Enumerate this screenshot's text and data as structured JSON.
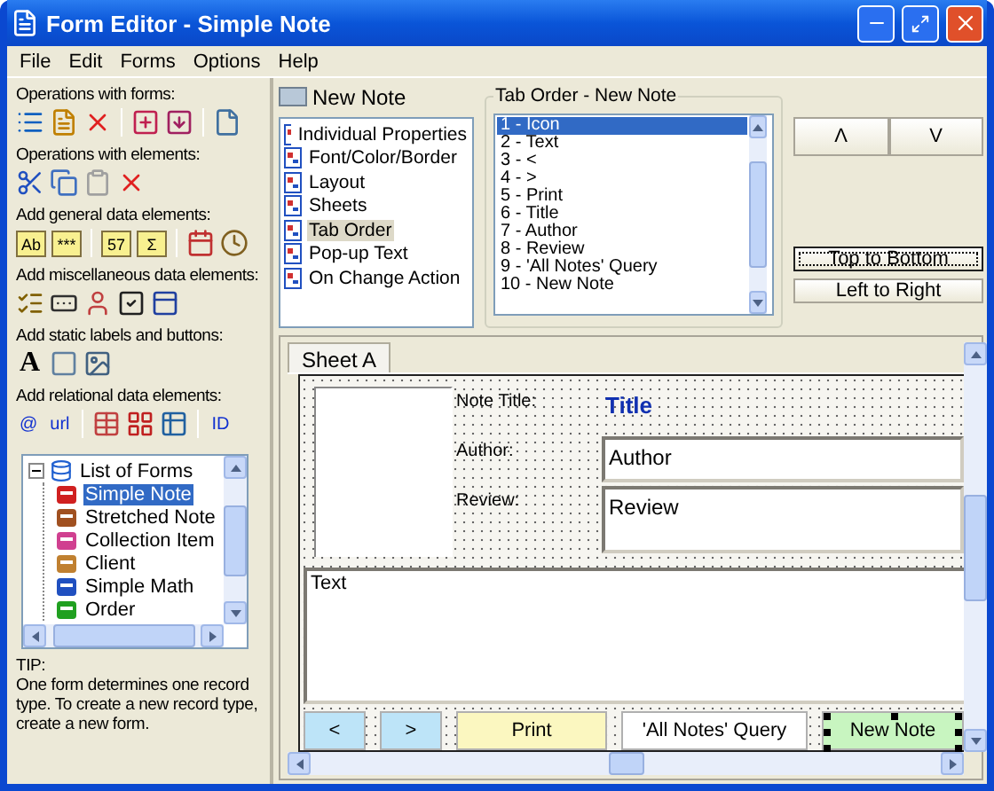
{
  "window": {
    "title": "Form Editor - Simple Note"
  },
  "menu": [
    "File",
    "Edit",
    "Forms",
    "Options",
    "Help"
  ],
  "toolbox": [
    {
      "title": "Operations with forms:",
      "items": [
        {
          "kind": "icon"
        },
        {
          "kind": "icon"
        },
        {
          "kind": "icon"
        },
        {
          "kind": "separator"
        },
        {
          "kind": "icon"
        },
        {
          "kind": "icon"
        },
        {
          "kind": "separator"
        },
        {
          "kind": "icon"
        }
      ]
    },
    {
      "title": "Operations with elements:",
      "items": [
        {
          "kind": "icon",
          "disabled": false
        },
        {
          "kind": "icon",
          "disabled": false
        },
        {
          "kind": "icon",
          "disabled": true
        },
        {
          "kind": "icon",
          "disabled": false
        }
      ]
    },
    {
      "title": "Add general data elements:",
      "items": [
        {
          "kind": "boxed",
          "text": "Ab"
        },
        {
          "kind": "boxed",
          "text": "***"
        },
        {
          "kind": "separator"
        },
        {
          "kind": "boxed",
          "text": "57"
        },
        {
          "kind": "boxed",
          "text": "Σ"
        },
        {
          "kind": "separator"
        },
        {
          "kind": "icon"
        },
        {
          "kind": "icon"
        }
      ]
    },
    {
      "title": "Add miscellaneous data elements:",
      "items": [
        {
          "kind": "icon"
        },
        {
          "kind": "icon"
        },
        {
          "kind": "icon"
        },
        {
          "kind": "icon"
        },
        {
          "kind": "icon"
        }
      ]
    },
    {
      "title": "Add static labels and buttons:",
      "items": [
        {
          "kind": "letter",
          "text": "A"
        },
        {
          "kind": "icon"
        },
        {
          "kind": "icon"
        }
      ]
    },
    {
      "title": "Add relational data elements:",
      "items": [
        {
          "kind": "link",
          "text": "@"
        },
        {
          "kind": "link",
          "text": "url"
        },
        {
          "kind": "separator"
        },
        {
          "kind": "icon"
        },
        {
          "kind": "icon"
        },
        {
          "kind": "icon"
        },
        {
          "kind": "separator"
        },
        {
          "kind": "link",
          "text": "ID"
        }
      ]
    }
  ],
  "forms_tree": {
    "label": "List of Forms",
    "expanded": true,
    "children": [
      {
        "label": "Simple Note",
        "selected": true
      },
      {
        "label": "Stretched Note",
        "selected": false
      },
      {
        "label": "Collection Item",
        "selected": false
      },
      {
        "label": "Client",
        "selected": false
      },
      {
        "label": "Simple Math",
        "selected": false
      },
      {
        "label": "Order",
        "selected": false
      }
    ]
  },
  "tip": {
    "title": "TIP:",
    "text": "One form determines one record type. To create a new record type, create a new form."
  },
  "form_header": "New Note",
  "property_pages": [
    {
      "label": "Individual Properties",
      "selected": false
    },
    {
      "label": "Font/Color/Border",
      "selected": false
    },
    {
      "label": "Layout",
      "selected": false
    },
    {
      "label": "Sheets",
      "selected": false
    },
    {
      "label": "Tab Order",
      "selected": true
    },
    {
      "label": "Pop-up Text",
      "selected": false
    },
    {
      "label": "On Change Action",
      "selected": false
    }
  ],
  "tab_order": {
    "title": "Tab Order - New Note",
    "items": [
      {
        "label": "1 - Icon",
        "selected": true
      },
      {
        "label": "2 - Text",
        "selected": false
      },
      {
        "label": "3 - <",
        "selected": false
      },
      {
        "label": "4 - >",
        "selected": false
      },
      {
        "label": "5 - Print",
        "selected": false
      },
      {
        "label": "6 - Title",
        "selected": false
      },
      {
        "label": "7 - Author",
        "selected": false
      },
      {
        "label": "8 - Review",
        "selected": false
      },
      {
        "label": "9 - 'All Notes' Query",
        "selected": false
      },
      {
        "label": "10 - New Note",
        "selected": false
      }
    ]
  },
  "order_buttons": [
    "Λ",
    "V"
  ],
  "arrange_buttons": [
    {
      "label": "Top to Bottom",
      "focused": true
    },
    {
      "label": "Left to Right",
      "focused": false
    }
  ],
  "sheet_tabs": [
    {
      "label": "Sheet A",
      "selected": true
    }
  ],
  "form": {
    "fields": [
      {
        "label": "Note Title:",
        "value": "Title",
        "kind": "title"
      },
      {
        "label": "Author:",
        "value": "Author",
        "kind": "input"
      },
      {
        "label": "Review:",
        "value": "Review",
        "kind": "memo"
      }
    ],
    "text_area": "Text",
    "buttons": [
      {
        "label": "<",
        "color": "#bde4f8",
        "selected": false
      },
      {
        "label": ">",
        "color": "#bde4f8",
        "selected": false
      },
      {
        "label": "Print",
        "color": "#fbf7c0",
        "selected": false
      },
      {
        "label": "'All Notes' Query",
        "color": "#ffffff",
        "selected": false
      },
      {
        "label": "New Note",
        "color": "#c8f5c0",
        "selected": true
      }
    ]
  }
}
